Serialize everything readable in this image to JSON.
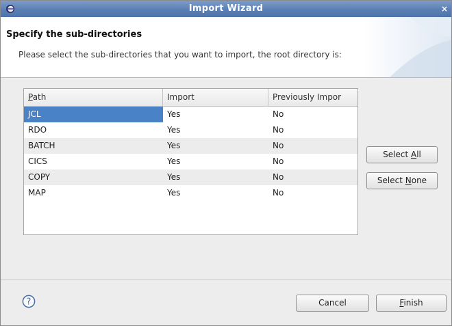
{
  "window": {
    "title": "Import Wizard",
    "close_glyph": "×",
    "icons": {
      "app": "eclipse-icon",
      "close": "close-icon",
      "help": "help-icon"
    }
  },
  "header": {
    "title": "Specify the sub-directories",
    "description": "Please select the sub-directories that you want to import, the root directory is:"
  },
  "table": {
    "columns": [
      {
        "mnemonic": "P",
        "rest": "ath"
      },
      {
        "label": "Import"
      },
      {
        "label": "Previously Impor"
      }
    ],
    "rows": [
      {
        "path": "JCL",
        "import": "Yes",
        "previously_imported": "No",
        "selected": true
      },
      {
        "path": "RDO",
        "import": "Yes",
        "previously_imported": "No"
      },
      {
        "path": "BATCH",
        "import": "Yes",
        "previously_imported": "No"
      },
      {
        "path": "CICS",
        "import": "Yes",
        "previously_imported": "No"
      },
      {
        "path": "COPY",
        "import": "Yes",
        "previously_imported": "No"
      },
      {
        "path": "MAP",
        "import": "Yes",
        "previously_imported": "No"
      }
    ]
  },
  "buttons": {
    "select_all": {
      "pre": "Select ",
      "mnemonic": "A",
      "post": "ll"
    },
    "select_none": {
      "pre": "Select ",
      "mnemonic": "N",
      "post": "one"
    },
    "cancel": {
      "label": "Cancel"
    },
    "finish": {
      "pre": "",
      "mnemonic": "F",
      "post": "inish"
    }
  },
  "colors": {
    "titlebar": "#5a7fb5",
    "selection": "#4a82c8",
    "stripe": "#ececec"
  }
}
